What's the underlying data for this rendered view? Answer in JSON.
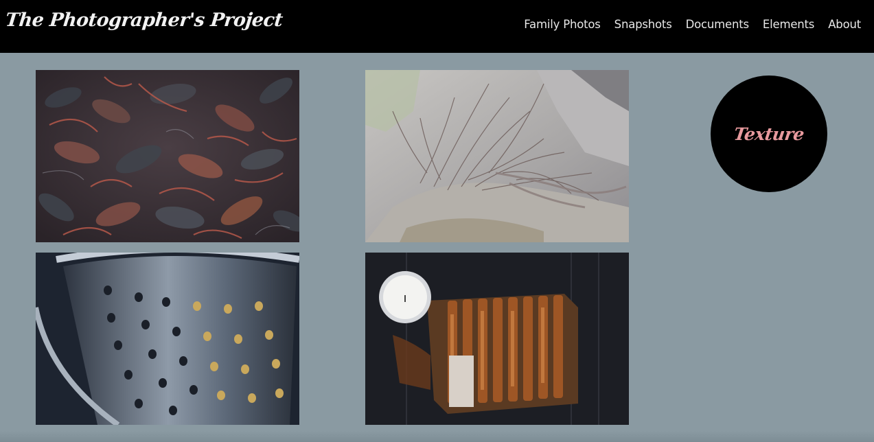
{
  "header": {
    "site_title": "The Photographer's Project",
    "nav": {
      "family_photos": "Family Photos",
      "snapshots": "Snapshots",
      "documents": "Documents",
      "elements": "Elements",
      "about": "About"
    }
  },
  "badge": {
    "label": "Texture",
    "label_color": "#e89a9e"
  },
  "colors": {
    "header_bg": "#000000",
    "page_bg": "#8a9aa2",
    "nav_text": "#e8e8e8"
  }
}
